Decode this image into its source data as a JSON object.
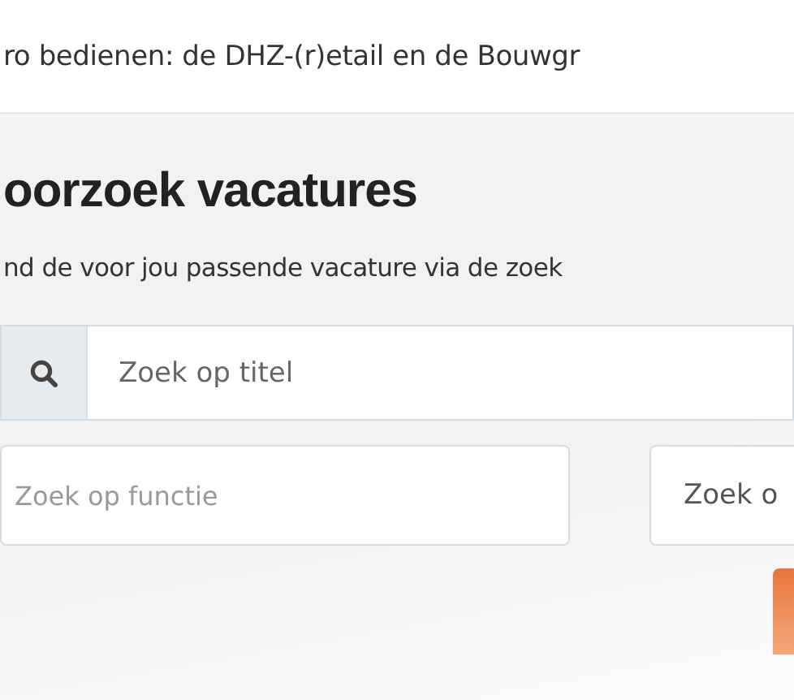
{
  "intro_text": "ro bedienen: de DHZ-(r)etail en de Bouwgr",
  "search_section": {
    "title": "oorzoek vacatures",
    "subtitle": "nd de voor jou passende vacature via de zoek",
    "title_search": {
      "placeholder": "Zoek op titel"
    },
    "filters": [
      {
        "placeholder": "Zoek op functie"
      },
      {
        "placeholder": "Zoek o"
      }
    ]
  }
}
